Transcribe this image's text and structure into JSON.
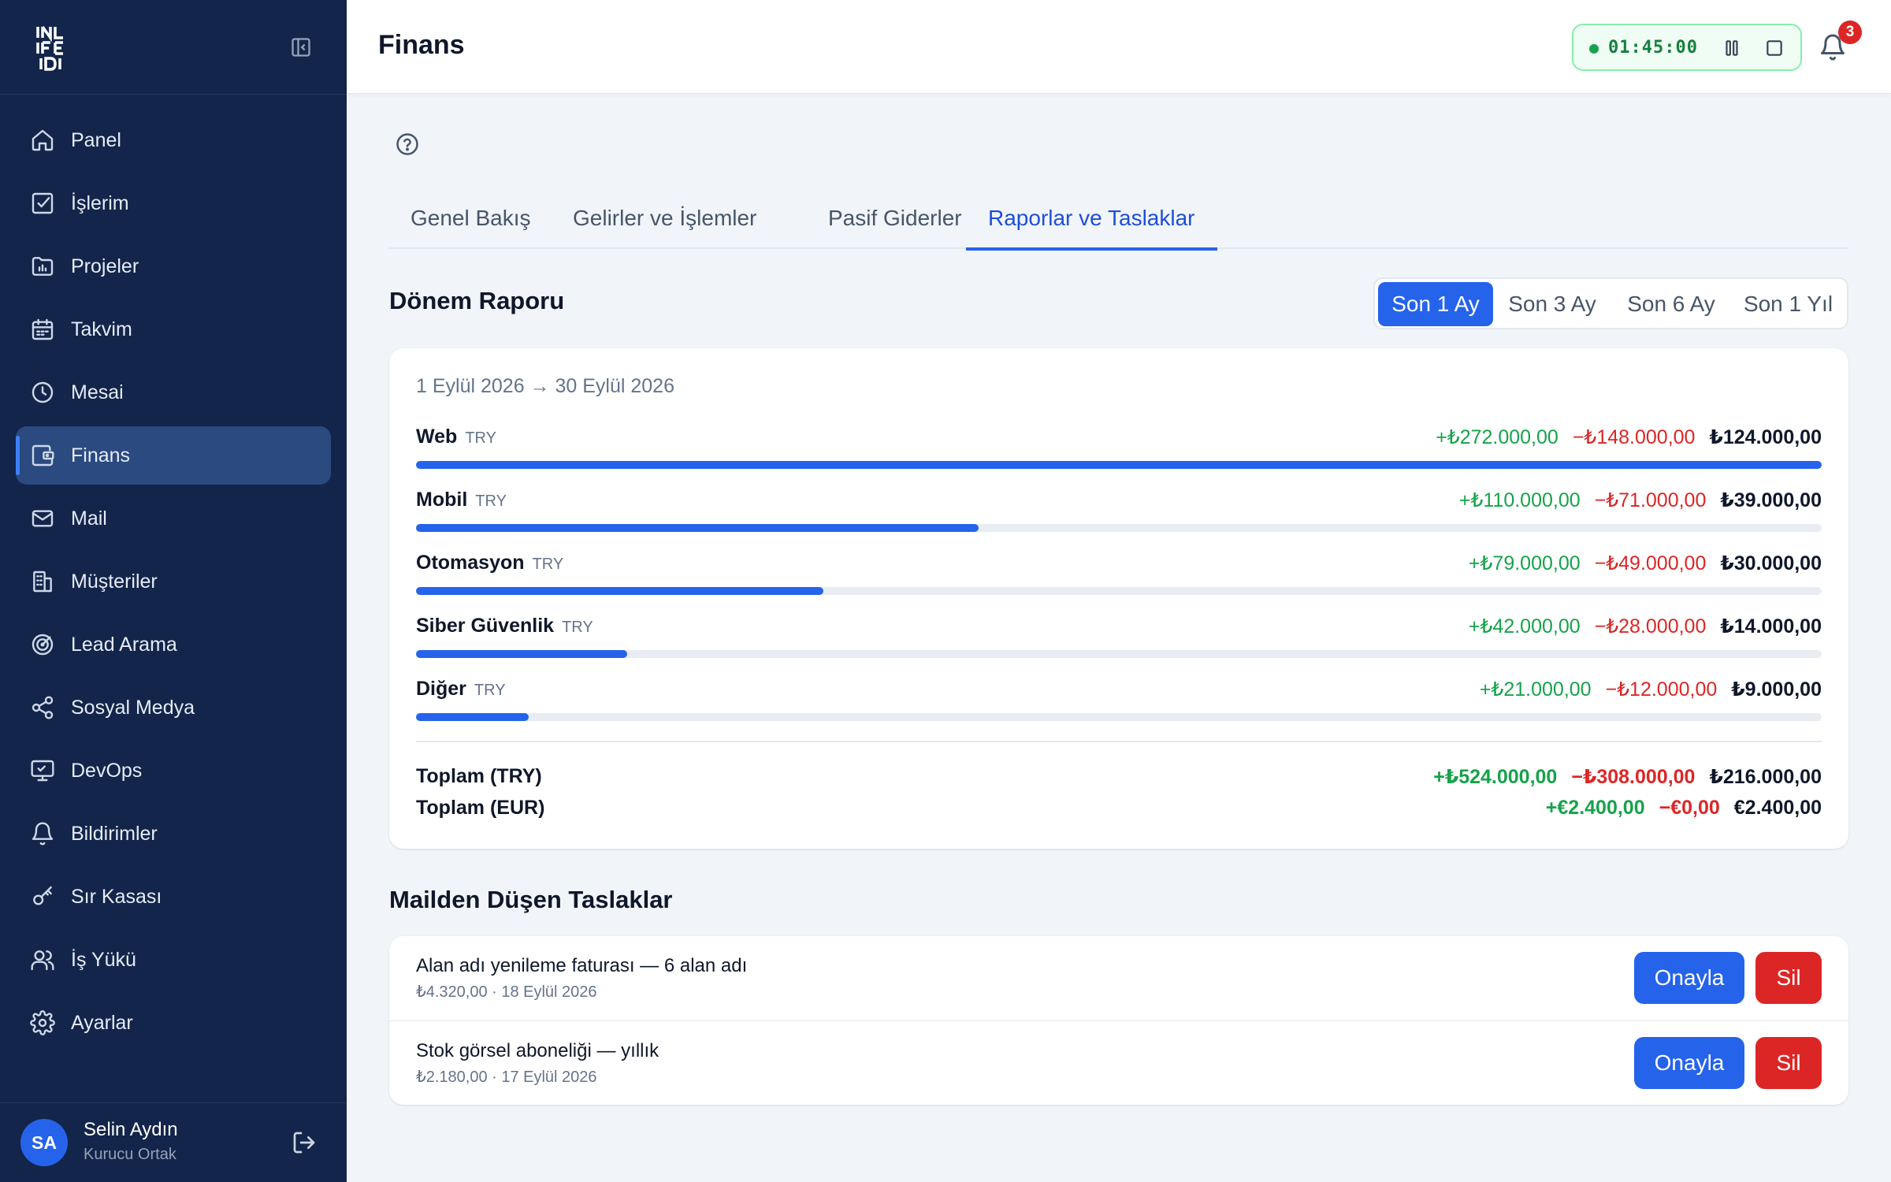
{
  "sidebar": {
    "items": [
      {
        "label": "Panel",
        "icon": "home-icon"
      },
      {
        "label": "İşlerim",
        "icon": "checkbox-icon"
      },
      {
        "label": "Projeler",
        "icon": "folder-chart-icon"
      },
      {
        "label": "Takvim",
        "icon": "calendar-icon"
      },
      {
        "label": "Mesai",
        "icon": "clock-icon"
      },
      {
        "label": "Finans",
        "icon": "wallet-icon",
        "active": true
      },
      {
        "label": "Mail",
        "icon": "mail-icon"
      },
      {
        "label": "Müşteriler",
        "icon": "building-icon"
      },
      {
        "label": "Lead Arama",
        "icon": "target-icon"
      },
      {
        "label": "Sosyal Medya",
        "icon": "share-icon"
      },
      {
        "label": "DevOps",
        "icon": "monitor-icon"
      },
      {
        "label": "Bildirimler",
        "icon": "bell-icon"
      },
      {
        "label": "Sır Kasası",
        "icon": "key-icon"
      },
      {
        "label": "İş Yükü",
        "icon": "users-icon"
      },
      {
        "label": "Ayarlar",
        "icon": "gear-icon"
      }
    ],
    "user": {
      "initials": "SA",
      "name": "Selin Aydın",
      "role": "Kurucu Ortak"
    }
  },
  "header": {
    "title": "Finans",
    "timer": "01:45:00",
    "notification_count": "3"
  },
  "tabs": [
    "Genel Bakış",
    "Gelirler ve İşlemler",
    "Pasif Giderler",
    "Raporlar ve Taslaklar"
  ],
  "active_tab": "Raporlar ve Taslaklar",
  "report": {
    "title": "Dönem Raporu",
    "periods": [
      "Son 1 Ay",
      "Son 3 Ay",
      "Son 6 Ay",
      "Son 1 Yıl"
    ],
    "active_period": "Son 1 Ay",
    "range": "1 Eylül 2026 → 30 Eylül 2026",
    "rows": [
      {
        "name": "Web",
        "currency": "TRY",
        "income": "+₺272.000,00",
        "expense": "−₺148.000,00",
        "net": "₺124.000,00",
        "share": 1.0
      },
      {
        "name": "Mobil",
        "currency": "TRY",
        "income": "+₺110.000,00",
        "expense": "−₺71.000,00",
        "net": "₺39.000,00",
        "share": 0.4
      },
      {
        "name": "Otomasyon",
        "currency": "TRY",
        "income": "+₺79.000,00",
        "expense": "−₺49.000,00",
        "net": "₺30.000,00",
        "share": 0.29
      },
      {
        "name": "Siber Güvenlik",
        "currency": "TRY",
        "income": "+₺42.000,00",
        "expense": "−₺28.000,00",
        "net": "₺14.000,00",
        "share": 0.15
      },
      {
        "name": "Diğer",
        "currency": "TRY",
        "income": "+₺21.000,00",
        "expense": "−₺12.000,00",
        "net": "₺9.000,00",
        "share": 0.08
      }
    ],
    "totals": [
      {
        "label": "Toplam (TRY)",
        "income": "+₺524.000,00",
        "expense": "−₺308.000,00",
        "net": "₺216.000,00"
      },
      {
        "label": "Toplam (EUR)",
        "income": "+€2.400,00",
        "expense": "−€0,00",
        "net": "€2.400,00"
      }
    ]
  },
  "drafts": {
    "title": "Mailden Düşen Taslaklar",
    "approve_label": "Onayla",
    "delete_label": "Sil",
    "items": [
      {
        "title": "Alan adı yenileme faturası — 6 alan adı",
        "sub": "₺4.320,00 · 18 Eylül 2026"
      },
      {
        "title": "Stok görsel aboneliği — yıllık",
        "sub": "₺2.180,00 · 17 Eylül 2026"
      }
    ]
  },
  "colors": {
    "sidebar": "#13254a",
    "accent": "#2563eb",
    "income": "#16a34a",
    "expense": "#dc2626"
  }
}
